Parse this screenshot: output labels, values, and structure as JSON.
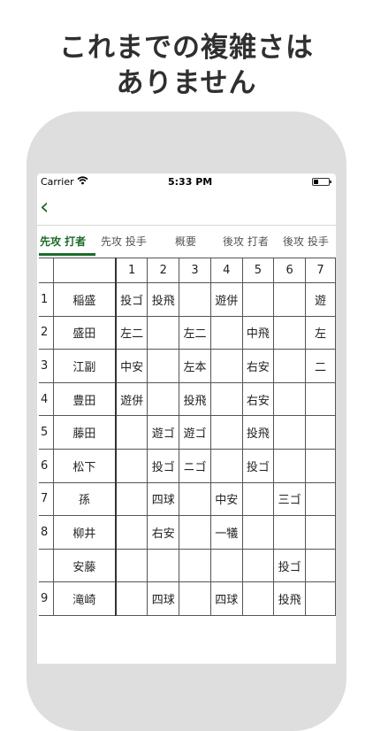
{
  "headline": [
    "これまでの複雑さは",
    "ありません"
  ],
  "statusbar": {
    "carrier": "Carrier",
    "time": "5:33 PM"
  },
  "nav": {
    "back_icon": "chevron-left"
  },
  "tabs": [
    {
      "label": "先攻 打者",
      "active": true
    },
    {
      "label": "先攻 投手",
      "active": false
    },
    {
      "label": "概要",
      "active": false
    },
    {
      "label": "後攻 打者",
      "active": false
    },
    {
      "label": "後攻 投手",
      "active": false
    }
  ],
  "innings": [
    "1",
    "2",
    "3",
    "4",
    "5",
    "6",
    "7"
  ],
  "rows": [
    {
      "order": "1",
      "name": "稲盛",
      "cells": [
        "投ゴ",
        "投飛",
        "",
        "遊併",
        "",
        "",
        "遊"
      ]
    },
    {
      "order": "2",
      "name": "盛田",
      "cells": [
        "左二",
        "",
        "左二",
        "",
        "中飛",
        "",
        "左"
      ]
    },
    {
      "order": "3",
      "name": "江副",
      "cells": [
        "中安",
        "",
        "左本",
        "",
        "右安",
        "",
        "二"
      ]
    },
    {
      "order": "4",
      "name": "豊田",
      "cells": [
        "遊併",
        "",
        "投飛",
        "",
        "右安",
        "",
        ""
      ]
    },
    {
      "order": "5",
      "name": "藤田",
      "cells": [
        "",
        "遊ゴ",
        "遊ゴ",
        "",
        "投飛",
        "",
        ""
      ]
    },
    {
      "order": "6",
      "name": "松下",
      "cells": [
        "",
        "投ゴ",
        "ニゴ",
        "",
        "投ゴ",
        "",
        ""
      ]
    },
    {
      "order": "7",
      "name": "孫",
      "cells": [
        "",
        "四球",
        "",
        "中安",
        "",
        "三ゴ",
        ""
      ]
    },
    {
      "order": "8",
      "name": "柳井",
      "cells": [
        "",
        "右安",
        "",
        "一犠",
        "",
        "",
        ""
      ]
    },
    {
      "order": "",
      "name": "安藤",
      "cells": [
        "",
        "",
        "",
        "",
        "",
        "投ゴ",
        ""
      ]
    },
    {
      "order": "9",
      "name": "滝崎",
      "cells": [
        "",
        "四球",
        "",
        "四球",
        "",
        "投飛",
        ""
      ]
    }
  ]
}
